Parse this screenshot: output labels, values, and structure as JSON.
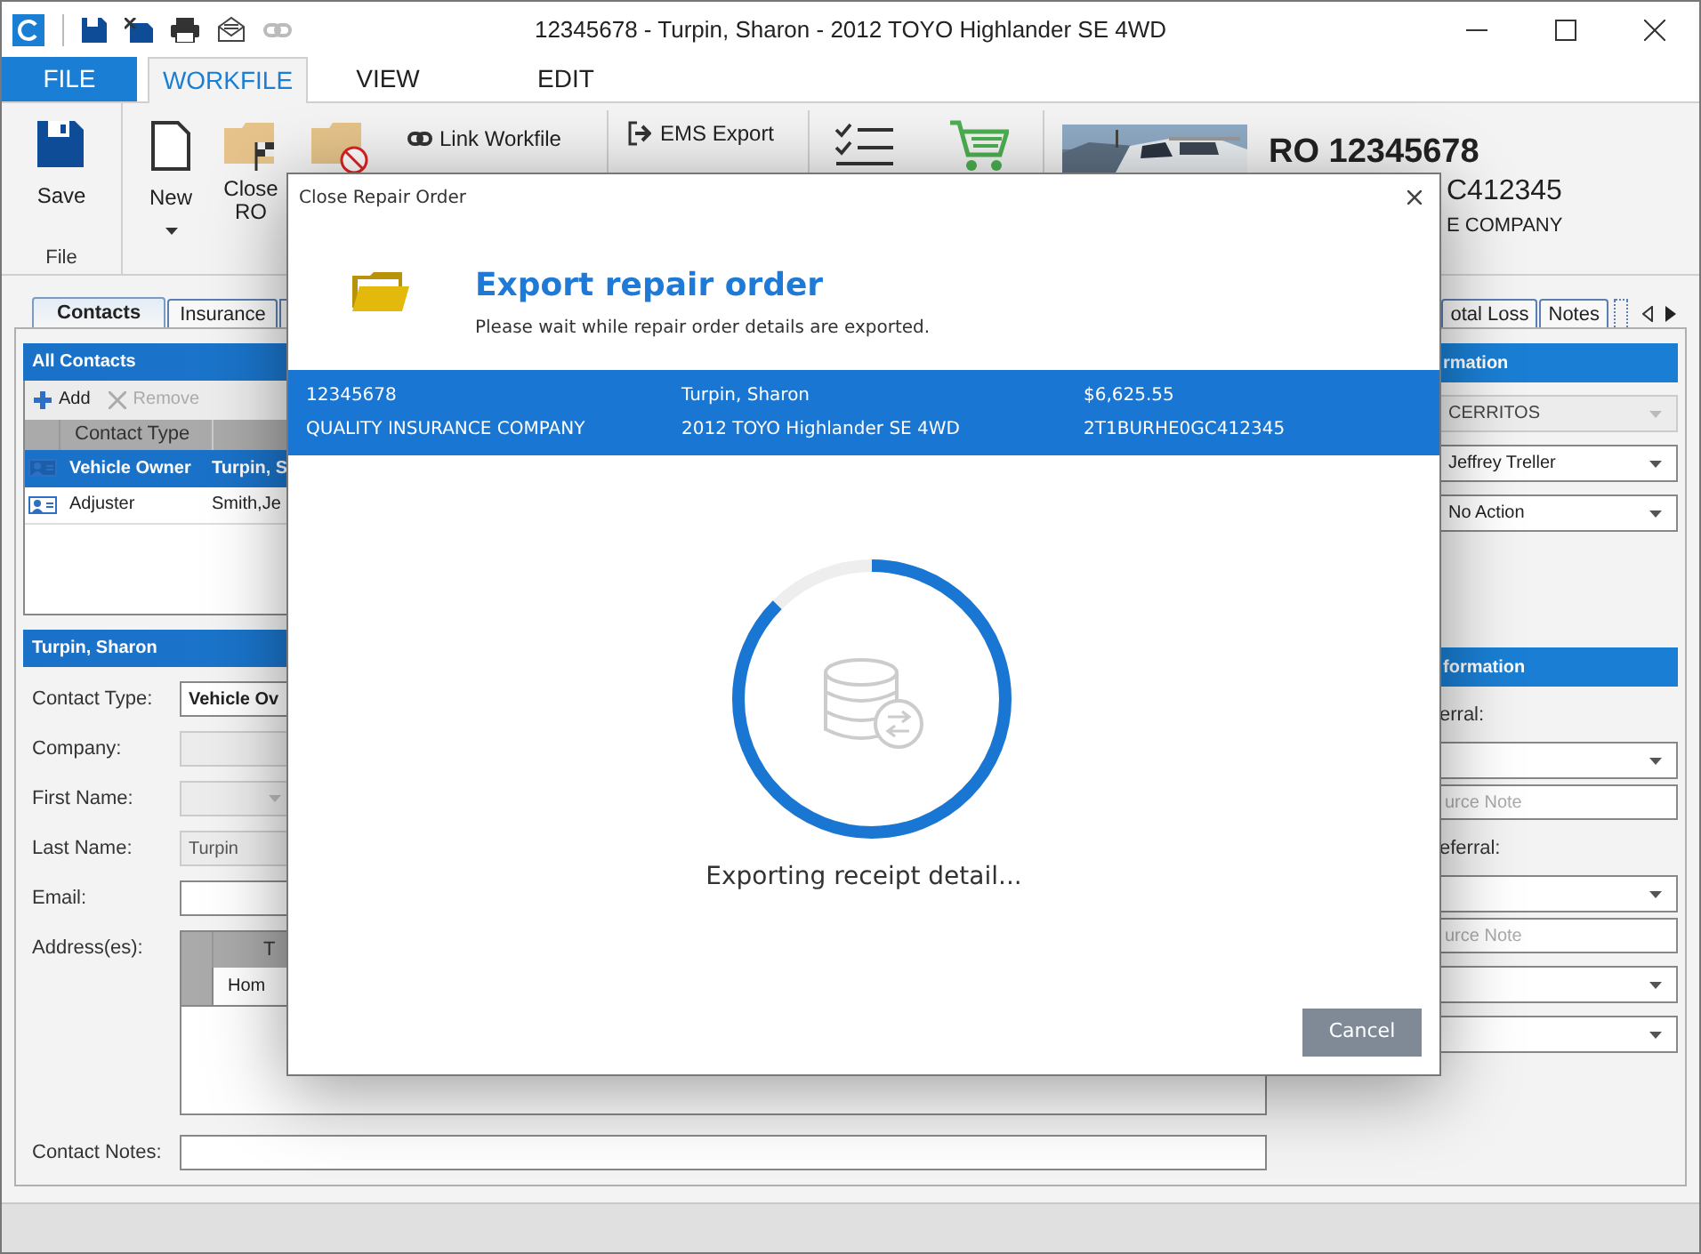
{
  "window": {
    "title": "12345678 - Turpin, Sharon - 2012 TOYO Highlander SE 4WD"
  },
  "ribbon_tabs": [
    {
      "label": "FILE",
      "kind": "file",
      "selected": false
    },
    {
      "label": "WORKFILE",
      "kind": "tab",
      "selected": true
    },
    {
      "label": "VIEW",
      "kind": "tab",
      "selected": false
    },
    {
      "label": "EDIT",
      "kind": "tab",
      "selected": false
    }
  ],
  "ribbon": {
    "save": "Save",
    "group_label": "File",
    "new": "New",
    "close_ro": "Close RO",
    "link_workfile": "Link Workfile",
    "ems_export": "EMS Export"
  },
  "ro_summary": {
    "ro_number": "RO 12345678",
    "vin": "C412345",
    "insurer": "E COMPANY"
  },
  "content_tabs": [
    {
      "label": "Contacts",
      "selected": true
    },
    {
      "label": "Insurance",
      "selected": false
    }
  ],
  "right_tabs": [
    {
      "label": "otal Loss",
      "selected": false
    },
    {
      "label": "Notes",
      "selected": false
    }
  ],
  "contacts": {
    "header": "All Contacts",
    "add": "Add",
    "remove": "Remove",
    "remove_disabled": true,
    "column_header": "Contact Type",
    "rows": [
      {
        "type": "Vehicle Owner",
        "name": "Turpin, S",
        "selected": true
      },
      {
        "type": "Adjuster",
        "name": "Smith,Je",
        "selected": false
      }
    ]
  },
  "contact_detail": {
    "header": "Turpin, Sharon",
    "fields": [
      {
        "label": "Contact Type:",
        "kind": "select",
        "value": "Vehicle Ov",
        "disabled": false
      },
      {
        "label": "Company:",
        "kind": "text",
        "disabled": true
      },
      {
        "label": "First Name:",
        "kind": "dropdown",
        "disabled": true
      },
      {
        "label": "Last Name:",
        "kind": "text",
        "value": "Turpin",
        "disabled": true
      },
      {
        "label": "Email:",
        "kind": "text",
        "disabled": false
      },
      {
        "label": "Address(es):",
        "kind": "grid",
        "header": "T",
        "rows": [
          "Hom"
        ]
      },
      {
        "label": "Contact Notes:",
        "kind": "notes",
        "disabled": false
      }
    ]
  },
  "right_panel": {
    "sections": [
      {
        "header": "rmation",
        "fields": [
          {
            "kind": "dropdown",
            "value": "CERRITOS",
            "disabled": true
          },
          {
            "kind": "dropdown",
            "value": "Jeffrey Treller",
            "disabled": false
          },
          {
            "kind": "dropdown",
            "value": "No Action",
            "disabled": false
          }
        ]
      },
      {
        "header": "formation",
        "fields": [
          {
            "kind": "label",
            "text": "erral:"
          },
          {
            "kind": "dropdown",
            "disabled": false
          },
          {
            "kind": "note",
            "placeholder": "urce Note"
          },
          {
            "kind": "label",
            "text": "eferral:"
          },
          {
            "kind": "dropdown",
            "disabled": false
          },
          {
            "kind": "note",
            "placeholder": "urce Note"
          },
          {
            "kind": "dropdown",
            "disabled": false
          },
          {
            "kind": "dropdown",
            "disabled": false
          }
        ]
      }
    ]
  },
  "dialog": {
    "title": "Close Repair Order",
    "heading": "Export repair order",
    "subtitle": "Please wait while repair order details are exported.",
    "summary": [
      [
        "12345678",
        "Turpin, Sharon",
        "$6,625.55"
      ],
      [
        "QUALITY INSURANCE COMPANY",
        "2012 TOYO Highlander SE 4WD",
        "2T1BURHE0GC412345"
      ]
    ],
    "status": "Exporting receipt detail...",
    "cancel": "Cancel"
  }
}
